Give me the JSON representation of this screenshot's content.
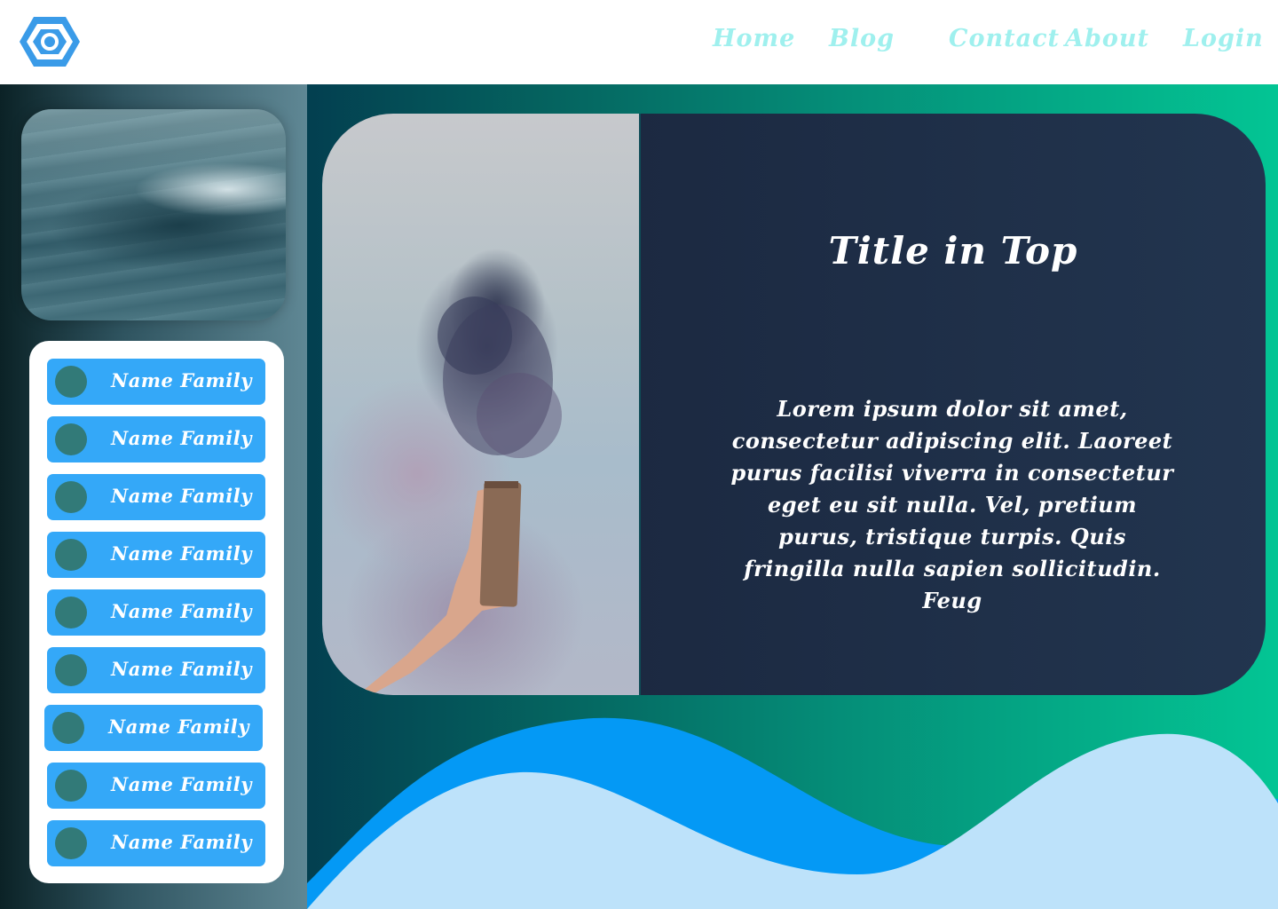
{
  "header": {
    "logo_icon": "hexagon-logo-icon",
    "nav": [
      {
        "label": "Home"
      },
      {
        "label": "Blog"
      },
      {
        "label": "Contact"
      },
      {
        "label": "About"
      },
      {
        "label": "Login"
      }
    ]
  },
  "sidebar": {
    "photo": "ocean-wave-photo",
    "names": [
      {
        "label": "Name Family"
      },
      {
        "label": "Name Family"
      },
      {
        "label": "Name Family"
      },
      {
        "label": "Name Family"
      },
      {
        "label": "Name Family"
      },
      {
        "label": "Name Family"
      },
      {
        "label": "Name Family"
      },
      {
        "label": "Name Family"
      },
      {
        "label": "Name Family"
      }
    ]
  },
  "main": {
    "photo": "smoke-bomb-photo",
    "title": "Title in Top",
    "body": "Lorem ipsum dolor sit amet, consectetur adipiscing elit. Laoreet purus facilisi viverra in consectetur eget eu sit nulla. Vel, pretium purus, tristique turpis. Quis fringilla nulla sapien sollicitudin. Feug"
  },
  "colors": {
    "nav_text": "#9ff0ee",
    "name_button": "#34a8f8",
    "avatar": "#327a78",
    "card": "#1c2a42",
    "wave_dark": "#0499f5",
    "wave_light": "#bde2fa"
  }
}
